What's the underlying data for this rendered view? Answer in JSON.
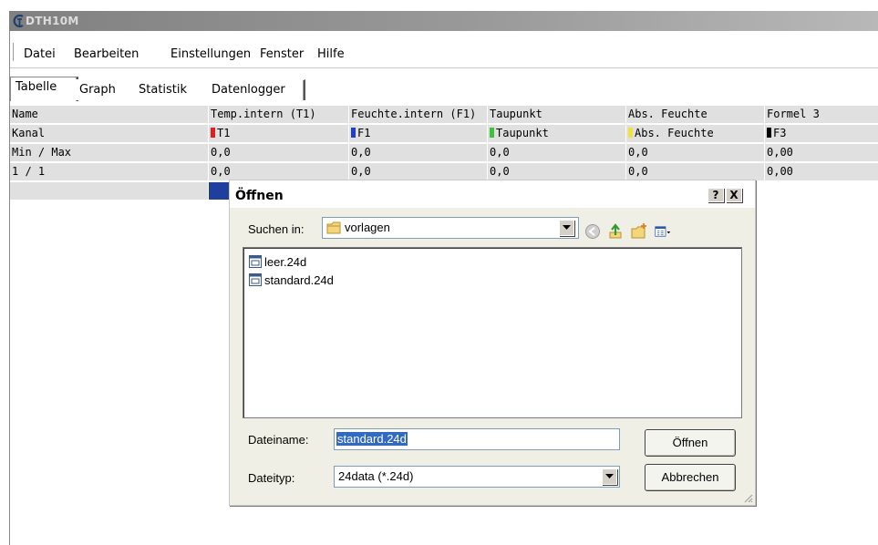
{
  "window": {
    "title": "DTH10M",
    "icon": "app-icon"
  },
  "menu": [
    "Datei",
    "Bearbeiten",
    "Einstellungen",
    "Fenster",
    "Hilfe"
  ],
  "tabs": [
    {
      "label": "Tabelle",
      "active": true
    },
    {
      "label": "Graph",
      "active": false
    },
    {
      "label": "Statistik",
      "active": false
    },
    {
      "label": "Datenlogger",
      "active": false
    }
  ],
  "table": {
    "headers": [
      "Name",
      "Temp.intern (T1)",
      "Feuchte.intern (F1)",
      "Taupunkt",
      "Abs. Feuchte",
      "Formel 3"
    ],
    "channels": [
      {
        "label": "Kanal",
        "color": ""
      },
      {
        "label": "T1",
        "color": "#e02020"
      },
      {
        "label": "F1",
        "color": "#2040d0"
      },
      {
        "label": "Taupunkt",
        "color": "#40c040"
      },
      {
        "label": "Abs. Feuchte",
        "color": "#f0e040"
      },
      {
        "label": "F3",
        "color": "#000000"
      }
    ],
    "rows": [
      [
        "Min / Max",
        "0,0",
        "0,0",
        "0,0",
        "0,0",
        "0,00"
      ],
      [
        "1 / 1",
        "0,0",
        "0,0",
        "0,0",
        "0,0",
        "0,00"
      ]
    ]
  },
  "dialog": {
    "title": "Öffnen",
    "help_button": "?",
    "close_button": "X",
    "look_in_label": "Suchen in:",
    "look_in_value": "vorlagen",
    "files": [
      "leer.24d",
      "standard.24d"
    ],
    "filename_label": "Dateiname:",
    "filename_value": "standard.24d",
    "filetype_label": "Dateityp:",
    "filetype_value": "24data (*.24d)",
    "open_button": "Öffnen",
    "cancel_button": "Abbrechen"
  }
}
